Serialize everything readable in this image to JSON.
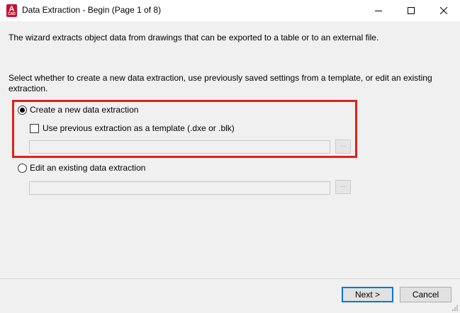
{
  "window": {
    "title": "Data Extraction - Begin (Page 1 of 8)",
    "app_icon_letter": "A",
    "app_icon_sub": "CAD"
  },
  "intro_text": "The wizard extracts object data from drawings that can be exported to a table or to an external file.",
  "instruction_text": "Select whether to create a new data extraction, use previously saved settings from a template, or edit an existing extraction.",
  "options": {
    "create_new": {
      "label": "Create a new data extraction",
      "selected": true
    },
    "use_template": {
      "label": "Use previous extraction as a template (.dxe or .blk)",
      "checked": false,
      "path_value": "",
      "browse_label": "..."
    },
    "edit_existing": {
      "label": "Edit an existing data extraction",
      "selected": false,
      "path_value": "",
      "browse_label": "..."
    }
  },
  "buttons": {
    "next": "Next >",
    "cancel": "Cancel"
  },
  "colors": {
    "highlight_border": "#e0201b",
    "default_button_border": "#0078d7",
    "app_icon": "#c8102e"
  }
}
